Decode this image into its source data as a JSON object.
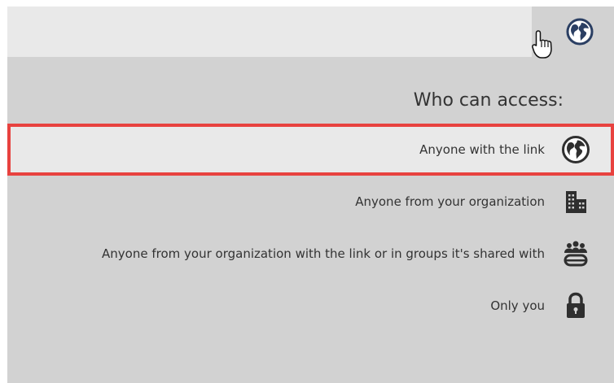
{
  "header": {
    "trigger_icon": "globe-icon"
  },
  "panel": {
    "title": "Who can access:",
    "options": [
      {
        "label": "Anyone with the link",
        "icon": "globe-icon",
        "selected": true
      },
      {
        "label": "Anyone from your organization",
        "icon": "building-icon",
        "selected": false
      },
      {
        "label": "Anyone from your organization with the link or in groups it's shared with",
        "icon": "group-link-icon",
        "selected": false
      },
      {
        "label": "Only you",
        "icon": "lock-icon",
        "selected": false
      }
    ]
  },
  "colors": {
    "panel_bg": "#d2d2d2",
    "selected_bg": "#e9e9e9",
    "selected_border": "#e8423f",
    "icon_dark": "#2f2f2f"
  }
}
